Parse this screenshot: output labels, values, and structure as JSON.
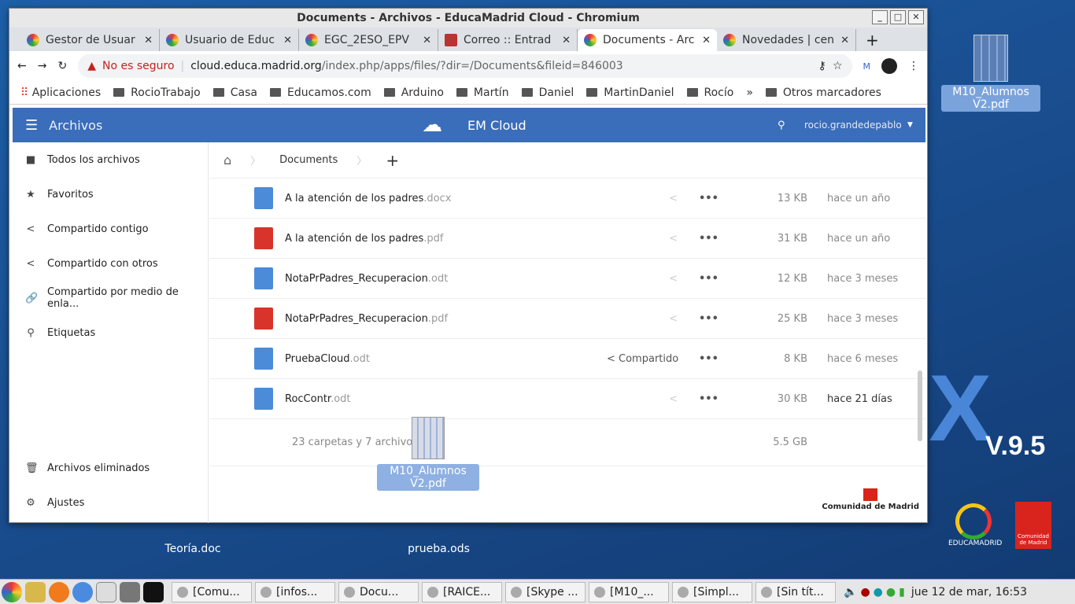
{
  "window": {
    "title": "Documents - Archivos - EducaMadrid Cloud - Chromium"
  },
  "tabs": [
    {
      "label": "Gestor de Usuar"
    },
    {
      "label": "Usuario de Educ"
    },
    {
      "label": "EGC_2ESO_EPV"
    },
    {
      "label": "Correo :: Entrad"
    },
    {
      "label": "Documents - Arc",
      "active": true
    },
    {
      "label": "Novedades | cen"
    }
  ],
  "address": {
    "security": "No es seguro",
    "host": "cloud.educa.madrid.org",
    "path": "/index.php/apps/files/?dir=/Documents&fileid=846003"
  },
  "bookmarks": [
    "Aplicaciones",
    "RocioTrabajo",
    "Casa",
    "Educamos.com",
    "Arduino",
    "Martín",
    "Daniel",
    "MartinDaniel",
    "Rocío"
  ],
  "bookmarks_other": "Otros marcadores",
  "app": {
    "section": "Archivos",
    "brand": "EM Cloud",
    "user": "rocio.grandedepablo"
  },
  "sidebar": [
    {
      "icon": "folder-icon",
      "label": "Todos los archivos"
    },
    {
      "icon": "star-icon",
      "label": "Favoritos"
    },
    {
      "icon": "share-icon",
      "label": "Compartido contigo"
    },
    {
      "icon": "share-icon",
      "label": "Compartido con otros"
    },
    {
      "icon": "link-icon",
      "label": "Compartido por medio de enla..."
    },
    {
      "icon": "search-icon",
      "label": "Etiquetas"
    }
  ],
  "sidebar_bottom": [
    {
      "label": "Archivos eliminados"
    },
    {
      "label": "Ajustes"
    }
  ],
  "breadcrumb": {
    "folder": "Documents"
  },
  "files": [
    {
      "name": "A la atención de los padres",
      "ext": ".docx",
      "type": "doc",
      "shared": "",
      "size": "13 KB",
      "date": "hace un año"
    },
    {
      "name": "A la atención de los padres",
      "ext": ".pdf",
      "type": "pdf",
      "shared": "",
      "size": "31 KB",
      "date": "hace un año"
    },
    {
      "name": "NotaPrPadres_Recuperacion",
      "ext": ".odt",
      "type": "doc",
      "shared": "",
      "size": "12 KB",
      "date": "hace 3 meses"
    },
    {
      "name": "NotaPrPadres_Recuperacion",
      "ext": ".pdf",
      "type": "pdf",
      "shared": "",
      "size": "25 KB",
      "date": "hace 3 meses"
    },
    {
      "name": "PruebaCloud",
      "ext": ".odt",
      "type": "doc",
      "shared": "Compartido",
      "size": "8 KB",
      "date": "hace 6 meses"
    },
    {
      "name": "RocContr",
      "ext": ".odt",
      "type": "doc",
      "shared": "",
      "size": "30 KB",
      "date": "hace 21 días"
    }
  ],
  "summary": {
    "count": "23 carpetas y 7 archivos",
    "size": "5.5 GB"
  },
  "footer_logo": "Comunidad de Madrid",
  "drag_file": "M10_Alumnos V2.pdf",
  "desktop": {
    "icons": [
      "M10_Alumnos V2.pdf",
      "Teoría.doc",
      "prueba.ods"
    ],
    "version": "V.9.5",
    "educamadrid": "EDUCAMADRID",
    "cm": "Comunidad de Madrid"
  },
  "taskbar": {
    "items": [
      "[Comu...",
      "[infos...",
      "Docu...",
      "[RAICE...",
      "[Skype ...",
      "[M10_...",
      "[Simpl...",
      "[Sin tít..."
    ],
    "clock": "jue 12 de mar, 16:53"
  }
}
